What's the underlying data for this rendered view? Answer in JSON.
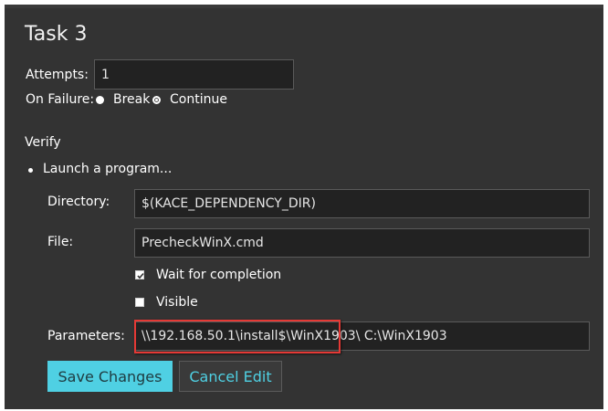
{
  "task": {
    "title": "Task 3",
    "attempts_label": "Attempts:",
    "attempts_value": "1",
    "on_failure_label": "On Failure:",
    "on_failure_options": [
      "Break",
      "Continue"
    ],
    "on_failure_selected": "Continue"
  },
  "verify": {
    "heading": "Verify",
    "item_label": "Launch a program..."
  },
  "program": {
    "directory_label": "Directory:",
    "directory_value": "$(KACE_DEPENDENCY_DIR)",
    "file_label": "File:",
    "file_value": "PrecheckWinX.cmd",
    "wait_label": "Wait for completion",
    "wait_checked": true,
    "visible_label": "Visible",
    "visible_checked": false,
    "parameters_label": "Parameters:",
    "parameters_value": "\\\\192.168.50.1\\install$\\WinX1903\\ C:\\WinX1903"
  },
  "actions": {
    "save_label": "Save Changes",
    "cancel_label": "Cancel Edit"
  },
  "colors": {
    "panel_bg": "#333333",
    "accent": "#4fd0e3",
    "highlight": "#e53935"
  }
}
